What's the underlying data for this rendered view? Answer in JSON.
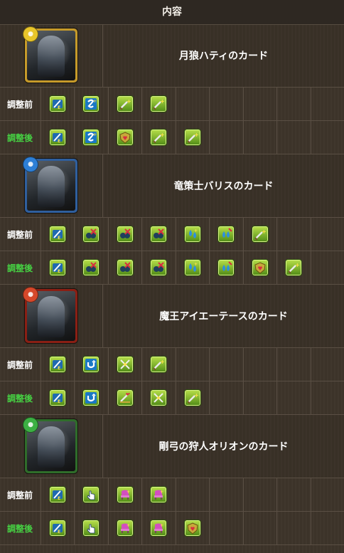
{
  "header": {
    "title": "内容"
  },
  "labels": {
    "before": "調整前",
    "after": "調整後"
  },
  "cards": [
    {
      "name": "月狼ハティのカード",
      "attribute": "light",
      "attribute_color": "#e8c52a",
      "frame_color": "#c69a2a",
      "before": [
        "enhanced-attack-icon",
        "combo-skill-icon",
        "sword-plus-icon",
        "sword-plus-icon"
      ],
      "after": [
        "enhanced-attack-icon",
        "combo-skill-icon",
        "shield-heart-icon",
        "sword-plus-icon",
        "sword-plus-icon"
      ]
    },
    {
      "name": "竜策士バリスのカード",
      "attribute": "water",
      "attribute_color": "#2d7fd6",
      "frame_color": "#2f5f9e",
      "before": [
        "enhanced-attack-icon",
        "bind-resist-icon",
        "bind-resist-icon",
        "bind-resist-icon",
        "water-drop-icon",
        "water-drop-plus-icon",
        "sword-plus-icon"
      ],
      "after": [
        "enhanced-attack-icon",
        "bind-resist-icon",
        "bind-resist-icon",
        "bind-resist-icon",
        "water-drop-icon",
        "water-drop-plus-icon",
        "shield-heart-icon",
        "sword-plus-icon"
      ]
    },
    {
      "name": "魔王アイエーテースのカード",
      "attribute": "fire",
      "attribute_color": "#d6482a",
      "frame_color": "#8a1f14",
      "before": [
        "enhanced-attack-icon",
        "u-turn-icon",
        "cross-swords-icon",
        "sword-plus-icon"
      ],
      "after": [
        "enhanced-attack-icon",
        "u-turn-icon",
        "sword-heart-icon",
        "cross-swords-icon",
        "sword-plus-icon"
      ]
    },
    {
      "name": "剛弓の狩人オリオンのカード",
      "attribute": "wood",
      "attribute_color": "#3cb043",
      "frame_color": "#2f6d2a",
      "before": [
        "enhanced-attack-icon",
        "hand-tap-icon",
        "pink-chair-icon",
        "pink-chair-icon"
      ],
      "after": [
        "enhanced-attack-icon",
        "hand-tap-icon",
        "pink-chair-icon",
        "pink-chair-icon",
        "shield-heart-icon"
      ]
    }
  ],
  "colors": {
    "accent_green": "#46d243",
    "background": "#3d342a"
  }
}
